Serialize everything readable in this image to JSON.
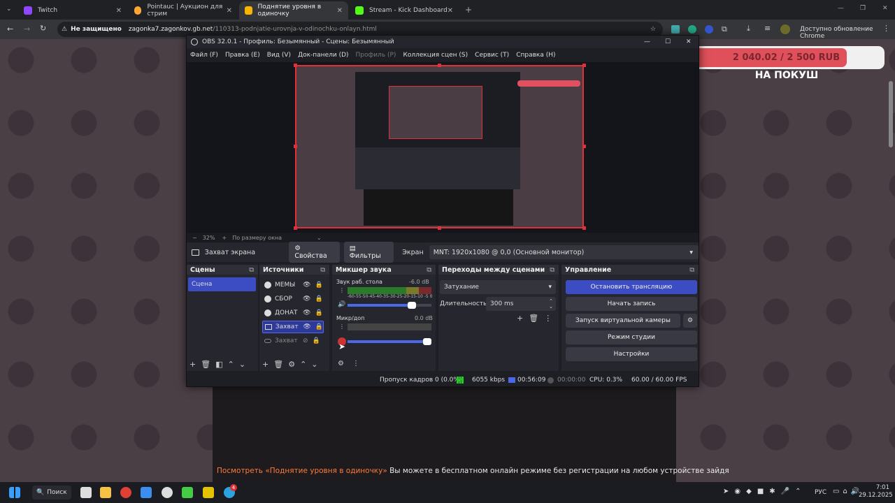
{
  "browser": {
    "tabs": [
      {
        "label": "Twitch",
        "color": "#9146ff"
      },
      {
        "label": "Pointauc | Аукцион для стрим",
        "color": "#ffa733"
      },
      {
        "label": "Поднятие уровня в одиночку",
        "color": "#f7b500"
      },
      {
        "label": "Stream - Kick Dashboard",
        "color": "#53fc18"
      }
    ],
    "security_label": "Не защищено",
    "url_host": "zagonka7.zagonkov.gb.net",
    "url_path": "/110313-podnjatie-urovnja-v-odinochku-onlayn.html",
    "update_label": "Доступно обновление Chrome"
  },
  "overlay": {
    "goal_text": "2 040.02 / 2 500 RUB",
    "goal_progress": 0.816,
    "goal_label": "НА ПОКУШ",
    "goal_color": "#e0505a"
  },
  "page": {
    "bottom_link": "Посмотреть «Поднятие уровня в одиночку»",
    "bottom_text": " Вы можете в бесплатном онлайн режиме без регистрации на любом устройстве зайдя"
  },
  "obs": {
    "title": "OBS 32.0.1 - Профиль: Безымянный - Сцены: Безымянный",
    "menu": [
      "Файл (F)",
      "Правка (E)",
      "Вид (V)",
      "Док-панели (D)",
      "Профиль (P)",
      "Коллекция сцен (S)",
      "Сервис (T)",
      "Справка (H)"
    ],
    "zoom": {
      "minus": "−",
      "value": "32%",
      "plus": "+",
      "fit": "По размеру окна"
    },
    "source_bar": {
      "name": "Захват экрана",
      "properties": "Свойства",
      "filters": "Фильтры",
      "screen_label": "Экран",
      "screen_value": "MNT: 1920x1080 @ 0,0 (Основной монитор)"
    },
    "scenes": {
      "title": "Сцены",
      "items": [
        "Сцена"
      ]
    },
    "sources": {
      "title": "Источники",
      "items": [
        "МЕМЫ",
        "СБОР",
        "ДОНАТ",
        "Захват",
        "Захват"
      ]
    },
    "mixer": {
      "title": "Микшер звука",
      "tracks": [
        {
          "name": "Звук раб. стола",
          "db": "-6.0 dB",
          "volume": 0.8
        },
        {
          "name": "Микр/доп",
          "db": "0.0 dB",
          "volume": 1.0
        }
      ],
      "scale": "-60-55-50-45-40-35-30-25-20-15-10 -5 0"
    },
    "transitions": {
      "title": "Переходы между сценами",
      "type": "Затухание",
      "duration_label": "Длительность",
      "duration": "300 ms"
    },
    "controls": {
      "title": "Управление",
      "buttons": [
        "Остановить трансляцию",
        "Начать запись",
        "Запуск виртуальной камеры",
        "Режим студии",
        "Настройки"
      ]
    },
    "status": {
      "dropped": "Пропуск кадров 0 (0.0%)",
      "bitrate": "6055 kbps",
      "stream_time": "00:56:09",
      "rec_time": "00:00:00",
      "cpu": "CPU: 0.3%",
      "fps": "60.00 / 60.00 FPS"
    }
  },
  "taskbar": {
    "search": "Поиск",
    "lang": "РУС",
    "time": "7:01",
    "date": "29.12.2025",
    "badge": "4"
  }
}
